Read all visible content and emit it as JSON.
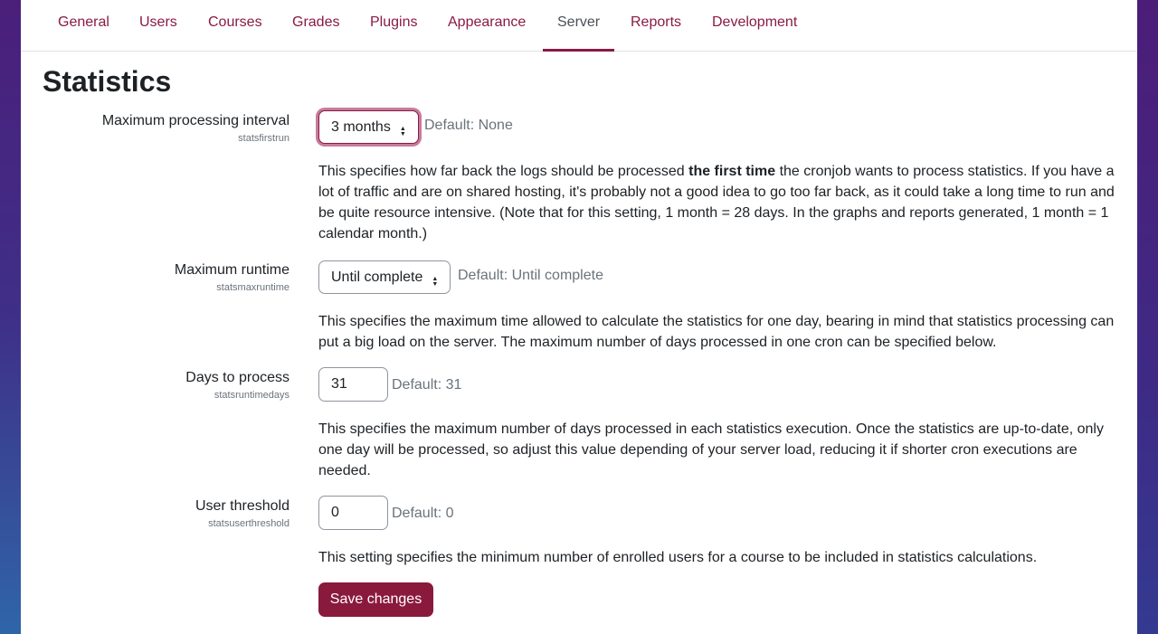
{
  "tabs": [
    {
      "label": "General",
      "active": false
    },
    {
      "label": "Users",
      "active": false
    },
    {
      "label": "Courses",
      "active": false
    },
    {
      "label": "Grades",
      "active": false
    },
    {
      "label": "Plugins",
      "active": false
    },
    {
      "label": "Appearance",
      "active": false
    },
    {
      "label": "Server",
      "active": true
    },
    {
      "label": "Reports",
      "active": false
    },
    {
      "label": "Development",
      "active": false
    }
  ],
  "page_title": "Statistics",
  "settings": [
    {
      "label": "Maximum processing interval",
      "name": "statsfirstrun",
      "control": "select",
      "value": "3 months",
      "default": "Default: None",
      "description_pre": "This specifies how far back the logs should be processed ",
      "description_bold": "the first time",
      "description_post": " the cronjob wants to process statistics. If you have a lot of traffic and are on shared hosting, it's probably not a good idea to go too far back, as it could take a long time to run and be quite resource intensive. (Note that for this setting, 1 month = 28 days. In the graphs and reports generated, 1 month = 1 calendar month.)"
    },
    {
      "label": "Maximum runtime",
      "name": "statsmaxruntime",
      "control": "select",
      "value": "Until complete",
      "default": "Default: Until complete",
      "description": "This specifies the maximum time allowed to calculate the statistics for one day, bearing in mind that statistics processing can put a big load on the server. The maximum number of days processed in one cron can be specified below."
    },
    {
      "label": "Days to process",
      "name": "statsruntimedays",
      "control": "text",
      "value": "31",
      "default": "Default: 31",
      "description": "This specifies the maximum number of days processed in each statistics execution. Once the statistics are up-to-date, only one day will be processed, so adjust this value depending of your server load, reducing it if shorter cron executions are needed."
    },
    {
      "label": "User threshold",
      "name": "statsuserthreshold",
      "control": "text",
      "value": "0",
      "default": "Default: 0",
      "description": "This setting specifies the minimum number of enrolled users for a course to be included in statistics calculations."
    }
  ],
  "save_label": "Save changes",
  "colors": {
    "brand": "#8a1a44",
    "button": "#8a1a3c",
    "focus_ring": "#c77b9b"
  },
  "icons": {
    "select_caret": "up-down-caret-icon"
  }
}
